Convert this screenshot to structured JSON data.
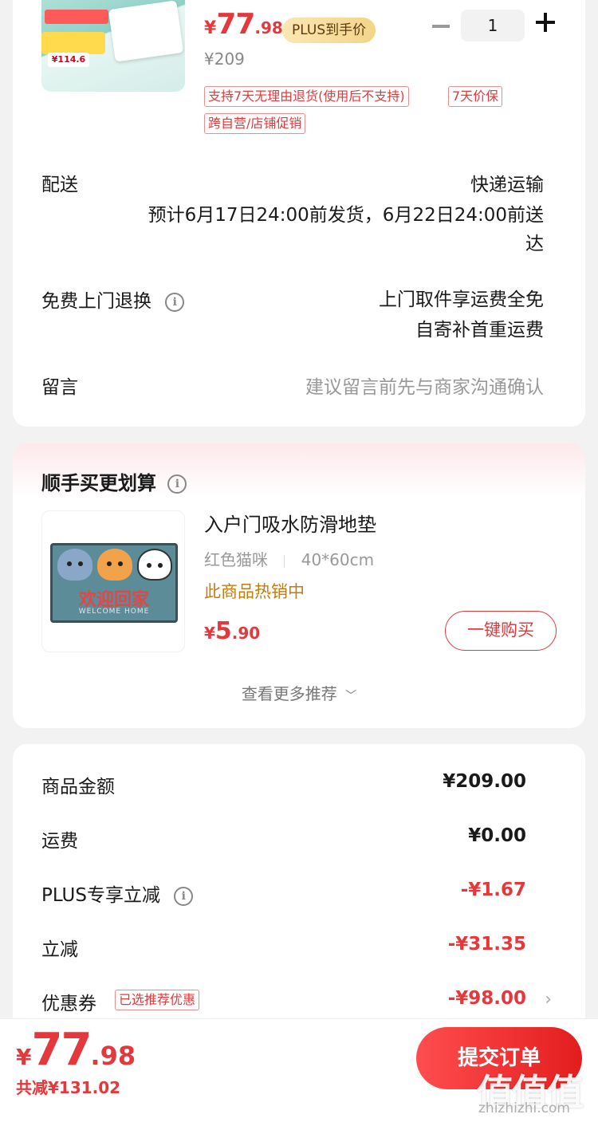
{
  "product": {
    "price_symbol": "¥",
    "price_int": "77",
    "price_dec": ".98",
    "plus_badge": "PLUS到手价",
    "original_price": "¥209",
    "quantity": "1",
    "tags": [
      "支持7天无理由退货(使用后不支持)",
      "7天价保",
      "跨自营/店铺促销"
    ],
    "thumb_badge": "¥114.6"
  },
  "delivery": {
    "label": "配送",
    "method": "快递运输",
    "estimate_line1": "预计6月17日24:00前发货，6月22日24:00前送",
    "estimate_line2": "达"
  },
  "returns": {
    "label": "免费上门退换",
    "line1": "上门取件享运费全免",
    "line2": "自寄补首重运费"
  },
  "note": {
    "label": "留言",
    "placeholder": "建议留言前先与商家沟通确认"
  },
  "upsell": {
    "title": "顺手买更划算",
    "item_name": "入户门吸水防滑地垫",
    "spec_color": "红色猫咪",
    "spec_size": "40*60cm",
    "hot": "此商品热销中",
    "price_symbol": "¥",
    "price_int": "5",
    "price_dec": ".90",
    "buy_label": "一键购买",
    "more_label": "查看更多推荐",
    "mat_text": "欢迎回家",
    "mat_sub": "WELCOME HOME"
  },
  "summary": {
    "rows": [
      {
        "label": "商品金额",
        "value": "¥209.00"
      },
      {
        "label": "运费",
        "value": "¥0.00"
      },
      {
        "label": "PLUS专享立减",
        "value": "-¥1.67"
      },
      {
        "label": "立减",
        "value": "-¥31.35"
      },
      {
        "label": "优惠券",
        "value": "-¥98.00",
        "tag": "已选推荐优惠"
      }
    ]
  },
  "bottom": {
    "price_symbol": "¥",
    "price_int": "77",
    "price_dec": ".98",
    "saved": "共减¥131.02",
    "submit": "提交订单",
    "watermark": "值值值",
    "watermark_url": "zhizhizhi.com"
  },
  "colors": {
    "accent": "#e4393c",
    "gold": "#c27c12",
    "background": "#f2f2f2"
  }
}
